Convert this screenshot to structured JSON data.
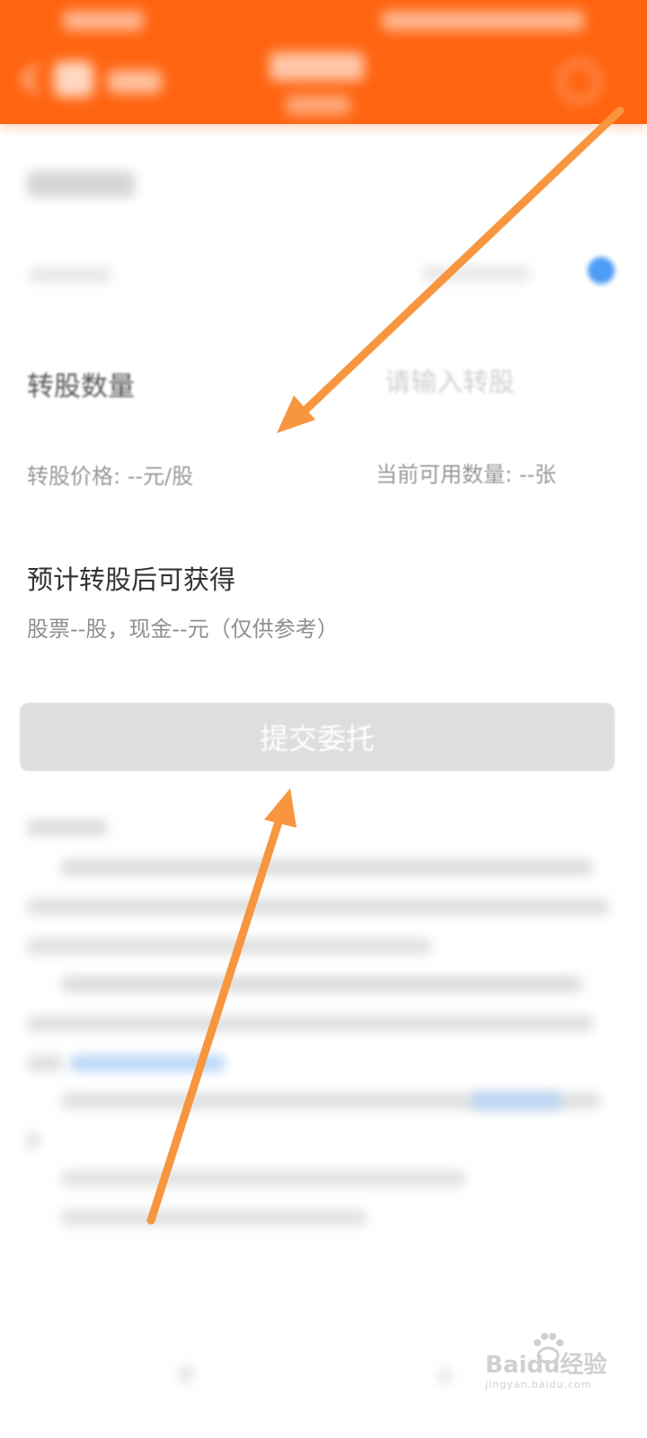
{
  "form": {
    "quantity_label": "转股数量",
    "quantity_placeholder": "请输入转股",
    "price_label": "转股价格:",
    "price_value": "--元/股",
    "available_label": "当前可用数量:",
    "available_value": "--张",
    "expect_title": "预计转股后可获得",
    "expect_detail": "股票--股，现金--元（仅供参考）",
    "submit_label": "提交委托"
  },
  "watermark": {
    "brand": "Baidu经验",
    "url": "jingyan.baidu.com"
  },
  "colors": {
    "header": "#ff6410",
    "arrow": "#f7963e",
    "toggle": "#4d9cf6",
    "button": "#dedede"
  }
}
